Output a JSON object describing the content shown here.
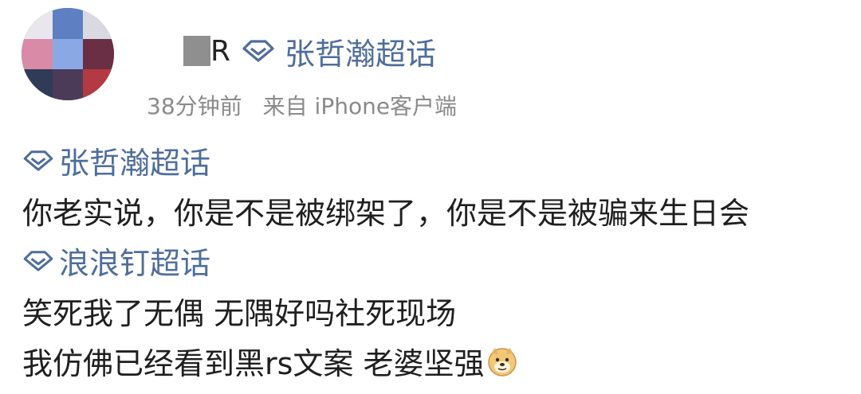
{
  "post": {
    "author": {
      "name_visible_fragment": "R",
      "topic": "张哲瀚超话"
    },
    "meta": {
      "time": "38分钟前",
      "source": "来自 iPhone客户端"
    },
    "tags": [
      {
        "label": "张哲瀚超话",
        "icon": "diamond-icon"
      },
      {
        "label": "浪浪钉超话",
        "icon": "diamond-icon"
      }
    ],
    "lines": [
      "你老实说，你是不是被绑架了，你是不是被骗来生日会",
      "笑死我了无偶 无隅好吗社死现场",
      "我仿佛已经看到黑rs文案 老婆坚强"
    ],
    "emoji": "doge-emoji"
  },
  "colors": {
    "topic_blue": "#4e6d9b",
    "text": "#1f1f1f",
    "meta_gray": "#8a8a8a"
  }
}
